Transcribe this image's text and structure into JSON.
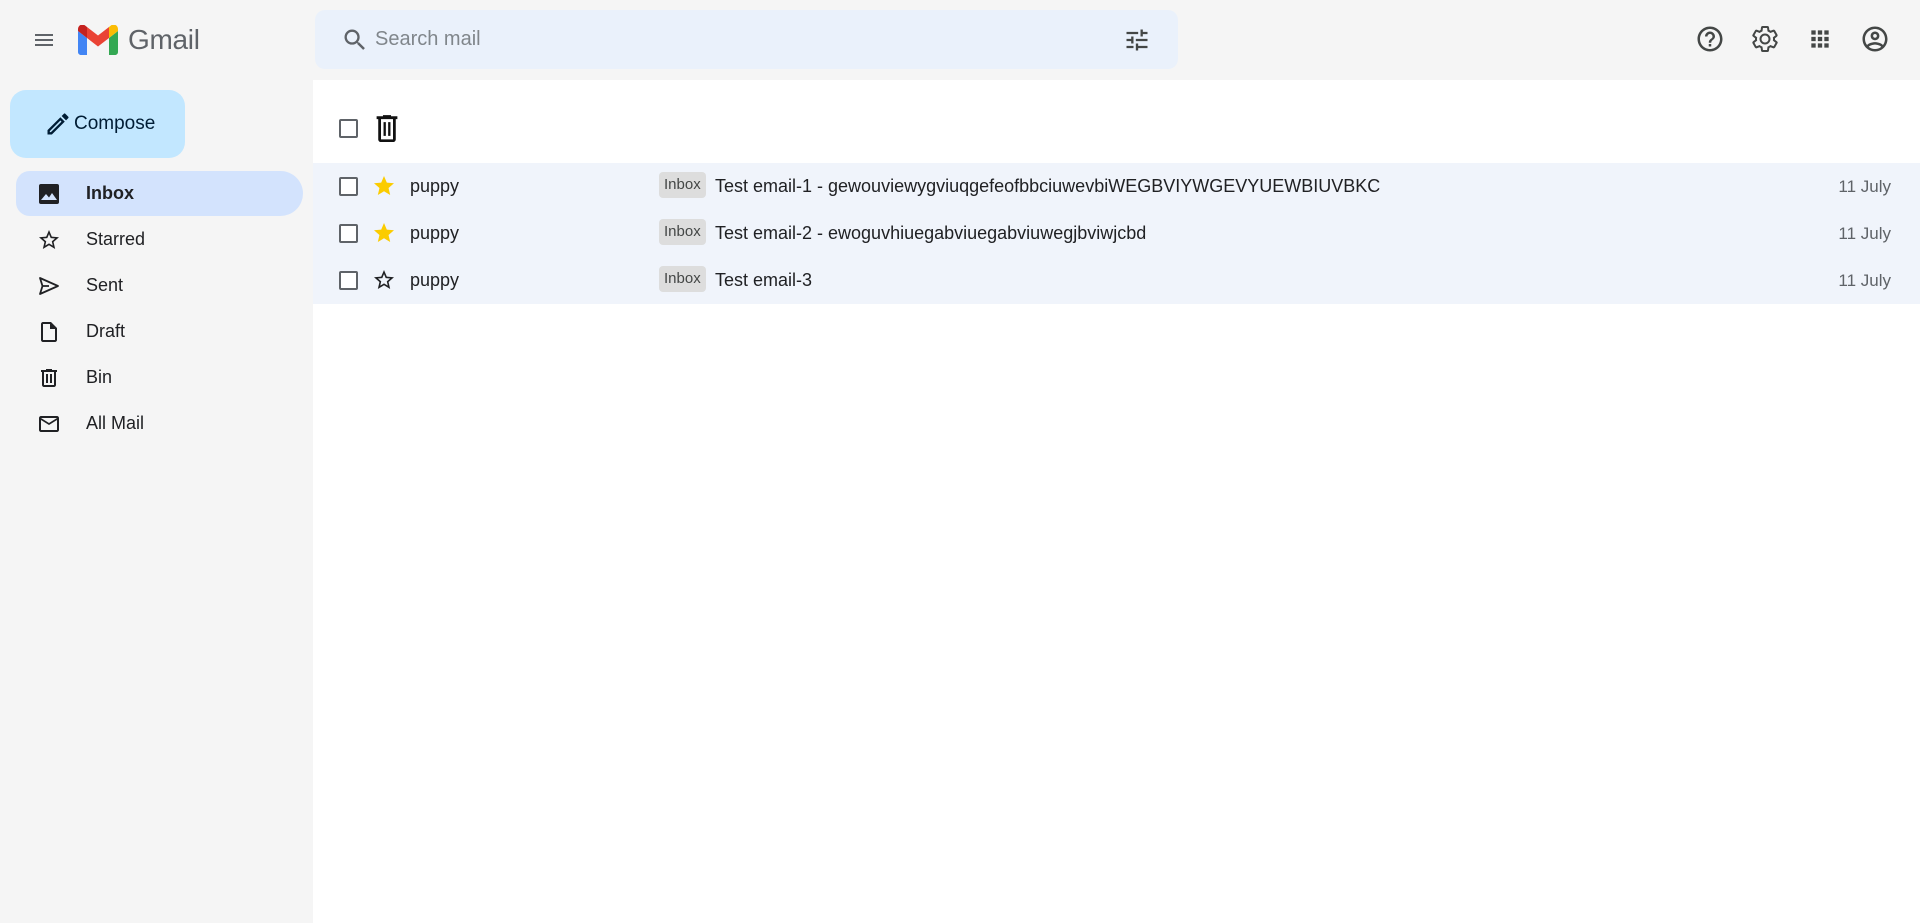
{
  "app": {
    "name": "Gmail"
  },
  "search": {
    "placeholder": "Search mail",
    "value": ""
  },
  "colors": {
    "accent": "#c2e7ff",
    "active_nav": "#d3e3fd",
    "star": "#fbcc00",
    "search_bg": "#eaf1fb",
    "row_bg": "#f0f4fb"
  },
  "header": {
    "icons": [
      "help-icon",
      "settings-icon",
      "apps-grid-icon",
      "account-icon"
    ]
  },
  "compose": {
    "label": "Compose"
  },
  "sidebar": {
    "items": [
      {
        "label": "Inbox",
        "icon": "inbox-icon",
        "active": true
      },
      {
        "label": "Starred",
        "icon": "star-outline-icon",
        "active": false
      },
      {
        "label": "Sent",
        "icon": "send-icon",
        "active": false
      },
      {
        "label": "Draft",
        "icon": "draft-icon",
        "active": false
      },
      {
        "label": "Bin",
        "icon": "trash-icon",
        "active": false
      },
      {
        "label": "All Mail",
        "icon": "mail-icon",
        "active": false
      }
    ]
  },
  "emails": [
    {
      "sender": "puppy",
      "starred": true,
      "label": "Inbox",
      "subject": "Test email-1 - gewouviewygviuqgefeofbbciuwevbiWEGBVIYWGEVYUEWBIUVBKC",
      "date": "11 July"
    },
    {
      "sender": "puppy",
      "starred": true,
      "label": "Inbox",
      "subject": "Test email-2 - ewoguvhiuegabviuegabviuwegjbviwjcbd",
      "date": "11 July"
    },
    {
      "sender": "puppy",
      "starred": false,
      "label": "Inbox",
      "subject": "Test email-3",
      "date": "11 July"
    }
  ]
}
